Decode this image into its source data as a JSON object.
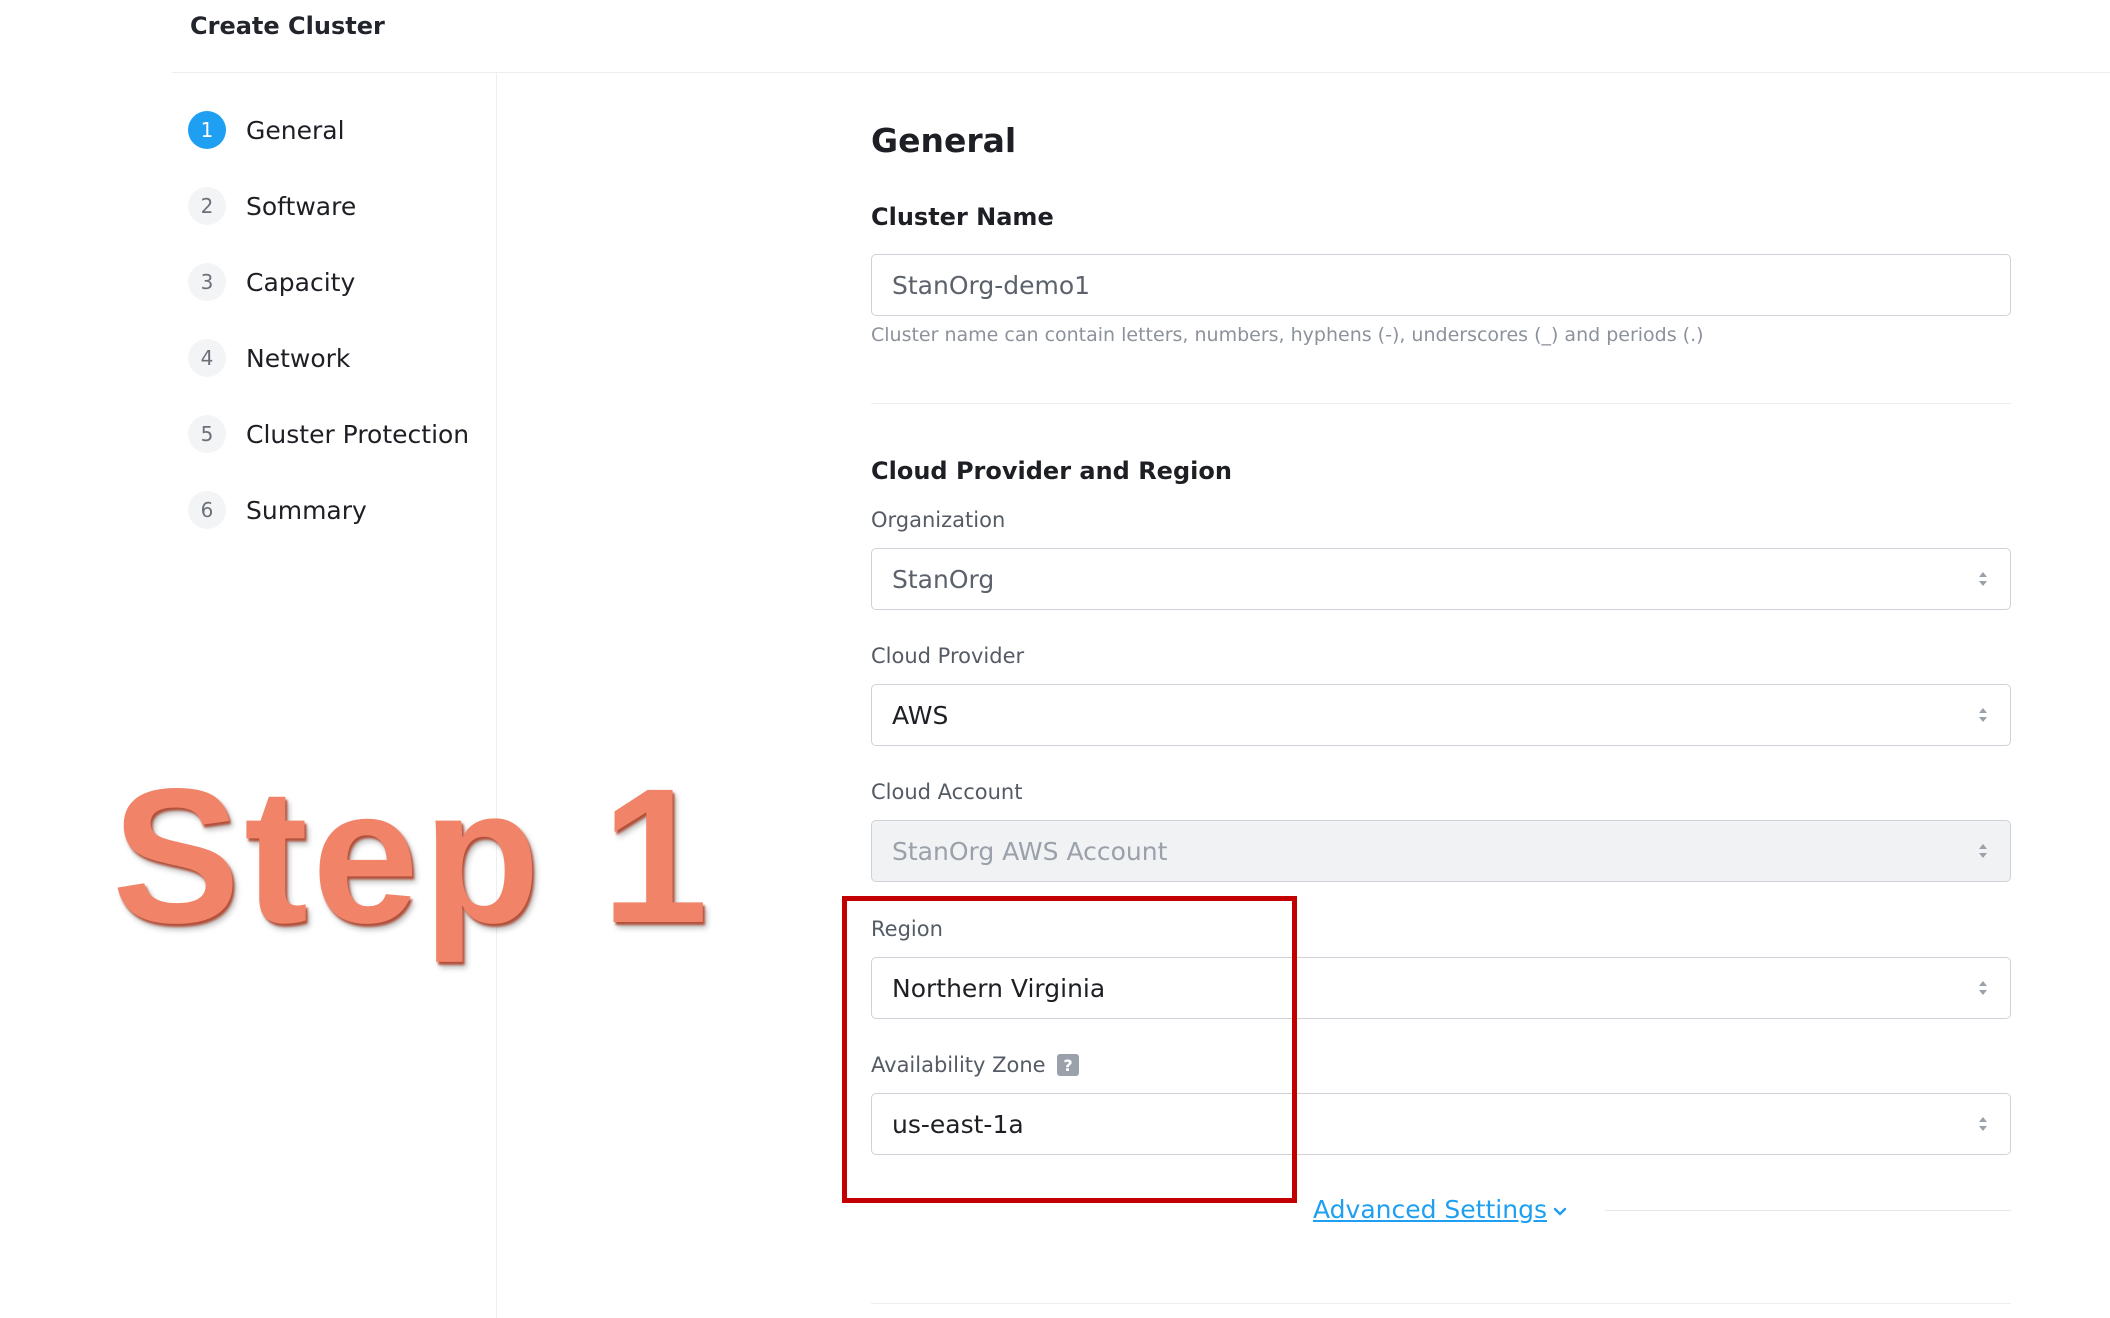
{
  "header": {
    "title": "Create Cluster"
  },
  "steps": [
    {
      "number": "1",
      "label": "General",
      "active": true
    },
    {
      "number": "2",
      "label": "Software",
      "active": false
    },
    {
      "number": "3",
      "label": "Capacity",
      "active": false
    },
    {
      "number": "4",
      "label": "Network",
      "active": false
    },
    {
      "number": "5",
      "label": "Cluster Protection",
      "active": false
    },
    {
      "number": "6",
      "label": "Summary",
      "active": false
    }
  ],
  "overlay": {
    "text": "Step 1",
    "color": "#f08368"
  },
  "form": {
    "section_title": "General",
    "cluster_name": {
      "heading": "Cluster Name",
      "value": "StanOrg-demo1",
      "help": "Cluster name can contain letters, numbers, hyphens (-), underscores (_) and periods (.)"
    },
    "cloud": {
      "heading": "Cloud Provider and Region",
      "organization": {
        "label": "Organization",
        "value": "StanOrg"
      },
      "provider": {
        "label": "Cloud Provider",
        "value": "AWS"
      },
      "account": {
        "label": "Cloud Account",
        "value": "StanOrg AWS Account",
        "disabled": true
      },
      "region": {
        "label": "Region",
        "value": "Northern Virginia"
      },
      "zone": {
        "label": "Availability Zone",
        "value": "us-east-1a",
        "help_icon": "?"
      }
    },
    "advanced": {
      "label": "Advanced Settings"
    }
  },
  "colors": {
    "accent": "#1e9ff2",
    "highlight": "#c20000"
  },
  "icons": [
    "select-arrows-icon",
    "help-icon",
    "chevron-down-icon"
  ]
}
